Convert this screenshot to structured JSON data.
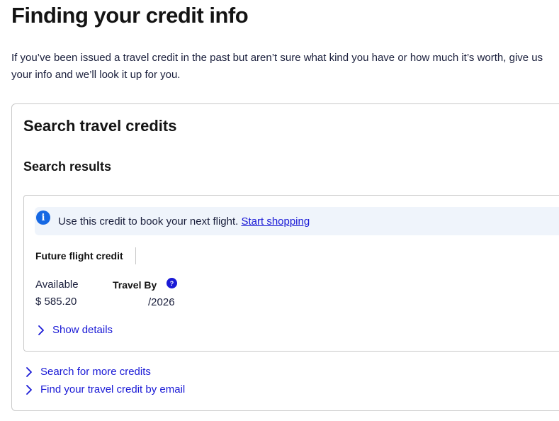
{
  "page": {
    "title": "Finding your credit info",
    "intro": "If you’ve been issued a travel credit in the past but aren’t sure what kind you have or how much it’s worth, give us your info and we’ll look it up for you."
  },
  "card": {
    "title": "Search travel credits",
    "results_title": "Search results"
  },
  "credit": {
    "banner_text": "Use this credit to book your next flight.",
    "banner_link": "Start shopping",
    "type": "Future flight credit",
    "available_label": "Available",
    "available_value": "$ 585.20",
    "travel_by_label": "Travel By",
    "travel_by_value": "/2026",
    "show_details": "Show details"
  },
  "links": {
    "more_credits": "Search for more credits",
    "by_email": "Find your travel credit by email"
  },
  "icons": {
    "info": "info-icon",
    "help": "help-icon",
    "chevron": "chevron-right-icon"
  },
  "colors": {
    "link": "#1a1ad6",
    "info_blue": "#1668e3",
    "banner_bg": "#eff4fb",
    "border": "#c9c9c9"
  }
}
